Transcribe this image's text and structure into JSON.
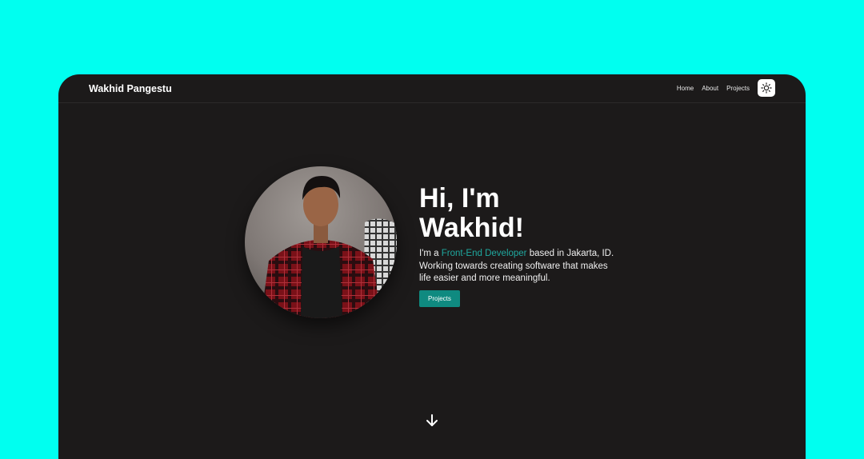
{
  "navbar": {
    "brand": "Wakhid Pangestu",
    "links": [
      "Home",
      "About",
      "Projects"
    ],
    "theme_toggle_icon": "sun-icon"
  },
  "hero": {
    "greeting_line1": "Hi, I'm",
    "greeting_line2": "Wakhid!",
    "bio_prefix": "I'm a ",
    "bio_highlight": "Front-End Developer",
    "bio_suffix": " based in Jakarta, ID. Working towards creating software that makes life easier and more meaningful.",
    "cta_label": "Projects",
    "scroll_icon": "arrow-down-icon"
  },
  "colors": {
    "page_background": "#00fff0",
    "frame_background": "#1c1a1a",
    "accent": "#1fa89f",
    "button": "#0f8a80"
  }
}
